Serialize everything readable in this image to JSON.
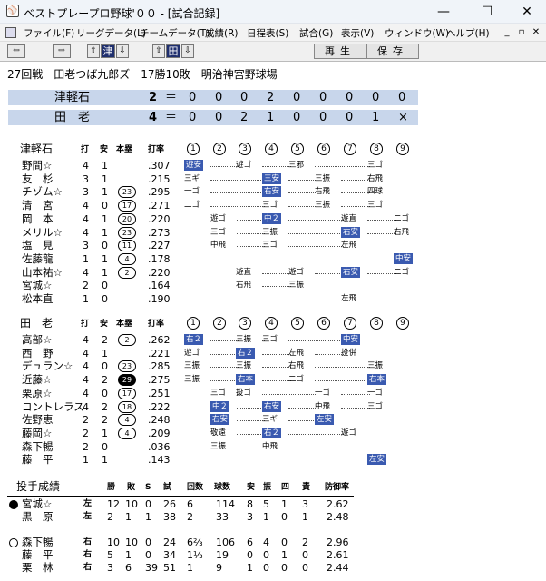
{
  "window": {
    "title": "ベストプレープロ野球'００ - [試合記録]",
    "min": "—",
    "max": "☐",
    "close": "✕"
  },
  "menu": [
    "ファイル(F)",
    "リーグデータ(L)",
    "チームデータ(T)",
    "成績(R)",
    "日程表(S)",
    "試合(G)",
    "表示(V)",
    "ウィンドウ(W)",
    "ヘルプ(H)"
  ],
  "mdi": [
    "_",
    "▫",
    "✕"
  ],
  "toolbar": {
    "left": "⇦",
    "right": "⇨",
    "up1": "⇧",
    "team1": "津",
    "down1": "⇩",
    "up2": "⇧",
    "team2": "田",
    "down2": "⇩",
    "replay": "再生",
    "save": "保存"
  },
  "game": {
    "header": "27回戦　田老つば九郎ズ　17勝10敗　明治神宮野球場",
    "lines": [
      {
        "team": "津軽石",
        "runs": "2",
        "eq": "＝",
        "innings": [
          "0",
          "0",
          "0",
          "2",
          "0",
          "0",
          "0",
          "0",
          "0"
        ]
      },
      {
        "team": "田　老",
        "runs": "4",
        "eq": "＝",
        "innings": [
          "0",
          "0",
          "2",
          "1",
          "0",
          "0",
          "0",
          "1",
          "×"
        ]
      }
    ]
  },
  "away": {
    "team": "津軽石",
    "h": [
      "打",
      "安",
      "本塁",
      "打率"
    ],
    "inn": [
      "1",
      "2",
      "3",
      "4",
      "5",
      "6",
      "7",
      "8",
      "9"
    ],
    "players": [
      {
        "name": "野間☆",
        "ab": "4",
        "hit": "1",
        "hr": "",
        "avg": ".307"
      },
      {
        "name": "友　杉",
        "ab": "3",
        "hit": "1",
        "hr": "",
        "avg": ".215"
      },
      {
        "name": "チゾム☆",
        "ab": "3",
        "hit": "1",
        "hr": "23",
        "avg": ".295"
      },
      {
        "name": "清　宮",
        "ab": "4",
        "hit": "0",
        "hr": "17",
        "avg": ".271"
      },
      {
        "name": "岡　本",
        "ab": "4",
        "hit": "1",
        "hr": "20",
        "avg": ".220"
      },
      {
        "name": "メリル☆",
        "ab": "4",
        "hit": "1",
        "hr": "23",
        "avg": ".273"
      },
      {
        "name": "塩　見",
        "ab": "3",
        "hit": "0",
        "hr": "11",
        "avg": ".227"
      },
      {
        "name": "佐藤龍",
        "ab": "1",
        "hit": "1",
        "hr": "4",
        "avg": ".178"
      },
      {
        "name": "山本祐☆",
        "ab": "4",
        "hit": "1",
        "hr": "2",
        "avg": ".220"
      },
      {
        "name": "宮城☆",
        "ab": "2",
        "hit": "0",
        "hr": "",
        "avg": ".164"
      },
      {
        "name": "松本直",
        "ab": "1",
        "hit": "0",
        "hr": "",
        "avg": ".190"
      }
    ],
    "results": [
      [
        "遊安",
        "",
        "遊ゴ",
        "",
        "三邪",
        "",
        "",
        "三ゴ",
        ""
      ],
      [
        "三ギ",
        "",
        "",
        "三安",
        "",
        "三振",
        "",
        "右飛",
        ""
      ],
      [
        "一ゴ",
        "",
        "",
        "右安",
        "",
        "右飛",
        "",
        "四球",
        ""
      ],
      [
        "二ゴ",
        "",
        "",
        "三ゴ",
        "",
        "三振",
        "",
        "三ゴ",
        ""
      ],
      [
        "",
        "遊ゴ",
        "",
        "中２",
        "",
        "",
        "遊直",
        "",
        "二ゴ"
      ],
      [
        "",
        "三ゴ",
        "",
        "三振",
        "",
        "",
        "右安",
        "",
        "右飛"
      ],
      [
        "",
        "中飛",
        "",
        "三ゴ",
        "",
        "",
        "左飛",
        "",
        ""
      ],
      [
        "",
        "",
        "",
        "",
        "",
        "",
        "",
        "",
        "中安"
      ],
      [
        "",
        "",
        "遊直",
        "",
        "遊ゴ",
        "",
        "右安",
        "",
        "二ゴ"
      ],
      [
        "",
        "",
        "右飛",
        "",
        "三振",
        "",
        "",
        "",
        ""
      ],
      [
        "",
        "",
        "",
        "",
        "",
        "",
        "左飛",
        "",
        ""
      ]
    ]
  },
  "home": {
    "team": "田　老",
    "h": [
      "打",
      "安",
      "本塁",
      "打率"
    ],
    "inn": [
      "1",
      "2",
      "3",
      "4",
      "5",
      "6",
      "7",
      "8",
      "9"
    ],
    "players": [
      {
        "name": "高部☆",
        "ab": "4",
        "hit": "2",
        "hr": "2",
        "avg": ".262"
      },
      {
        "name": "西　野",
        "ab": "4",
        "hit": "1",
        "hr": "",
        "avg": ".221"
      },
      {
        "name": "デュラン☆",
        "ab": "4",
        "hit": "0",
        "hr": "23",
        "avg": ".285"
      },
      {
        "name": "近藤☆",
        "ab": "4",
        "hit": "2",
        "hr": "29",
        "avg": ".275"
      },
      {
        "name": "栗原☆",
        "ab": "4",
        "hit": "0",
        "hr": "17",
        "avg": ".251"
      },
      {
        "name": "コントレラス",
        "ab": "4",
        "hit": "2",
        "hr": "18",
        "avg": ".222"
      },
      {
        "name": "佐野恵",
        "ab": "2",
        "hit": "2",
        "hr": "4",
        "avg": ".248"
      },
      {
        "name": "藤岡☆",
        "ab": "2",
        "hit": "1",
        "hr": "4",
        "avg": ".209"
      },
      {
        "name": "森下暢",
        "ab": "2",
        "hit": "0",
        "hr": "",
        "avg": ".036"
      },
      {
        "name": "藤　平",
        "ab": "1",
        "hit": "1",
        "hr": "",
        "avg": ".143"
      }
    ],
    "results": [
      [
        "右２",
        "",
        "三振",
        "三ゴ",
        "",
        "",
        "中安",
        "",
        ""
      ],
      [
        "遊ゴ",
        "",
        "右２",
        "",
        "左飛",
        "",
        "投併",
        "",
        ""
      ],
      [
        "三振",
        "",
        "三振",
        "",
        "右飛",
        "",
        "",
        "三振",
        ""
      ],
      [
        "三振",
        "",
        "右本",
        "",
        "二ゴ",
        "",
        "",
        "右本",
        ""
      ],
      [
        "",
        "三ゴ",
        "投ゴ",
        "",
        "",
        "一ゴ",
        "",
        "一ゴ",
        ""
      ],
      [
        "",
        "中２",
        "",
        "右安",
        "",
        "中飛",
        "",
        "三ゴ",
        ""
      ],
      [
        "",
        "右安",
        "",
        "三ギ",
        "",
        "左安",
        "",
        "",
        ""
      ],
      [
        "",
        "敬遠",
        "",
        "右２",
        "",
        "",
        "遊ゴ",
        "",
        ""
      ],
      [
        "",
        "三振",
        "",
        "中飛",
        "",
        "",
        "",
        "",
        ""
      ],
      [
        "",
        "",
        "",
        "",
        "",
        "",
        "",
        "左安",
        ""
      ]
    ]
  },
  "pitching": {
    "title": "投手成績",
    "h": [
      "勝",
      "敗",
      "S",
      "試",
      "回数",
      "球数",
      "安",
      "振",
      "四",
      "責",
      "防御率"
    ],
    "away": [
      {
        "name": "宮城☆",
        "hand": "左",
        "w": "12",
        "l": "10",
        "s": "0",
        "g": "26",
        "ip": "6",
        "pc": "114",
        "h": "8",
        "k": "5",
        "bb": "1",
        "er": "3",
        "era": "2.62"
      },
      {
        "name": "黒　原",
        "hand": "左",
        "w": "2",
        "l": "1",
        "s": "1",
        "g": "38",
        "ip": "2",
        "pc": "33",
        "h": "3",
        "k": "1",
        "bb": "0",
        "er": "1",
        "era": "2.48"
      }
    ],
    "home": [
      {
        "name": "森下暢",
        "hand": "右",
        "w": "10",
        "l": "10",
        "s": "0",
        "g": "24",
        "ip": "6⅔",
        "pc": "106",
        "h": "6",
        "k": "4",
        "bb": "0",
        "er": "2",
        "era": "2.96"
      },
      {
        "name": "藤　平",
        "hand": "右",
        "w": "5",
        "l": "1",
        "s": "0",
        "g": "34",
        "ip": "1⅓",
        "pc": "19",
        "h": "0",
        "k": "0",
        "bb": "1",
        "er": "0",
        "era": "2.61"
      },
      {
        "name": "栗　林",
        "hand": "右",
        "w": "3",
        "l": "6",
        "s": "39",
        "g": "51",
        "ip": "1",
        "pc": "9",
        "h": "1",
        "k": "0",
        "bb": "0",
        "er": "0",
        "era": "2.44"
      }
    ],
    "markers": {
      "s_label": "S"
    }
  },
  "highlight": [
    "遊安",
    "三安",
    "右安",
    "中２",
    "中安",
    "右２",
    "右本",
    "中安",
    "左安"
  ],
  "colors": {
    "highlight": "#3a5ab0",
    "scoreband": "#c8d6eb",
    "toolbar_dark": "#1f2f6e"
  }
}
